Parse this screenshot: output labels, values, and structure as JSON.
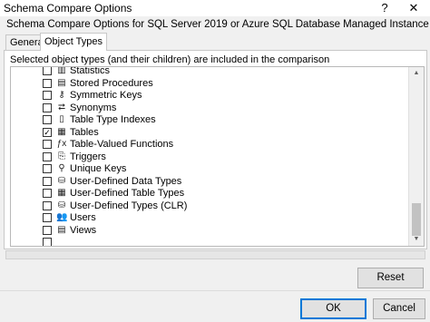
{
  "window": {
    "title": "Schema Compare Options",
    "help_glyph": "?",
    "close_glyph": "✕"
  },
  "subtitle": "Schema Compare Options for SQL Server 2019 or Azure SQL Database Managed Instance",
  "tabs": [
    {
      "label": "General",
      "active": false
    },
    {
      "label": "Object Types",
      "active": true
    }
  ],
  "description": "Selected object types (and their children) are included in the comparison",
  "object_types": [
    {
      "label": "Statistics",
      "checked": false,
      "icon": "bar-chart-icon",
      "glyph": "▥"
    },
    {
      "label": "Stored Procedures",
      "checked": false,
      "icon": "stored-procedure-icon",
      "glyph": "▤"
    },
    {
      "label": "Symmetric Keys",
      "checked": false,
      "icon": "symmetric-key-icon",
      "glyph": "⚷"
    },
    {
      "label": "Synonyms",
      "checked": false,
      "icon": "synonym-icon",
      "glyph": "⮂"
    },
    {
      "label": "Table Type Indexes",
      "checked": false,
      "icon": "index-icon",
      "glyph": "▯"
    },
    {
      "label": "Tables",
      "checked": true,
      "icon": "table-icon",
      "glyph": "▦"
    },
    {
      "label": "Table-Valued Functions",
      "checked": false,
      "icon": "function-icon",
      "glyph": "ƒx"
    },
    {
      "label": "Triggers",
      "checked": false,
      "icon": "trigger-icon",
      "glyph": "⎘"
    },
    {
      "label": "Unique Keys",
      "checked": false,
      "icon": "key-icon",
      "glyph": "⚲"
    },
    {
      "label": "User-Defined Data Types",
      "checked": false,
      "icon": "user-defined-type-icon",
      "glyph": "⛁"
    },
    {
      "label": "User-Defined Table Types",
      "checked": false,
      "icon": "table-type-icon",
      "glyph": "▦"
    },
    {
      "label": "User-Defined Types (CLR)",
      "checked": false,
      "icon": "clr-type-icon",
      "glyph": "⛁"
    },
    {
      "label": "Users",
      "checked": false,
      "icon": "users-icon",
      "glyph": "👥"
    },
    {
      "label": "Views",
      "checked": false,
      "icon": "view-icon",
      "glyph": "▤"
    },
    {
      "label": "",
      "checked": false,
      "icon": "partial-item-icon",
      "glyph": ""
    }
  ],
  "buttons": {
    "reset": "Reset",
    "ok": "OK",
    "cancel": "Cancel"
  },
  "colors": {
    "accent": "#0078d7"
  }
}
